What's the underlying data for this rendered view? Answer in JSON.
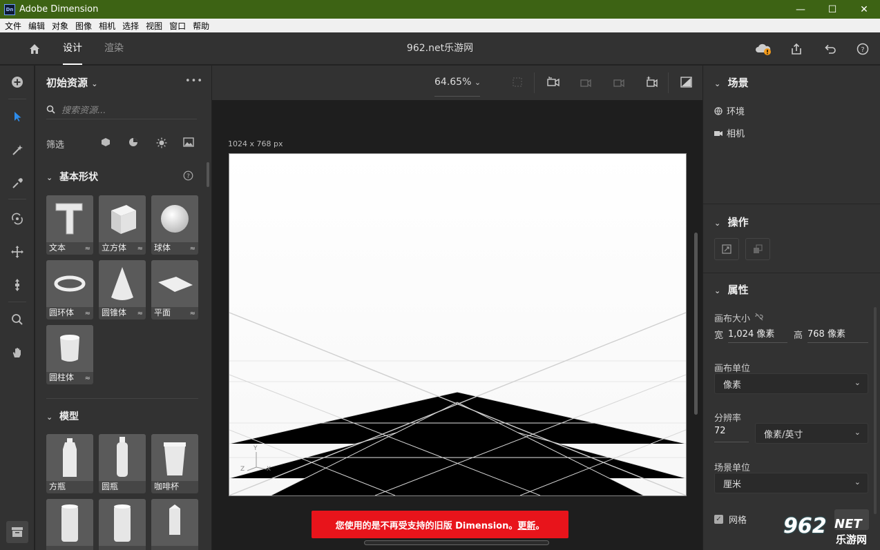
{
  "window": {
    "title": "Adobe Dimension",
    "logo": "Dn",
    "minimize": "—",
    "maximize": "☐",
    "close": "✕"
  },
  "menu": [
    "文件",
    "编辑",
    "对象",
    "图像",
    "相机",
    "选择",
    "视图",
    "窗口",
    "帮助"
  ],
  "header": {
    "tab_design": "设计",
    "tab_render": "渲染",
    "doc_title": "962.net乐游网"
  },
  "assets": {
    "title": "初始资源",
    "more": "•••",
    "search_placeholder": "搜索资源...",
    "filter_label": "筛选",
    "basic_shapes": {
      "title": "基本形状",
      "items": [
        "文本",
        "立方体",
        "球体",
        "圆环体",
        "圆锥体",
        "平面",
        "圆柱体"
      ]
    },
    "models": {
      "title": "模型",
      "items": [
        "方瓶",
        "圆瓶",
        "咖啡杯",
        "",
        ""
      ]
    }
  },
  "canvas": {
    "zoom": "64.65%",
    "size_label": "1024 x 768 px",
    "axis_y": "Y",
    "axis_x": "X",
    "axis_z": "Z"
  },
  "banner": {
    "text": "您使用的是不再受支持的旧版 Dimension。",
    "link": "更新",
    "end": "。",
    "color": "#e8141b"
  },
  "scene": {
    "title": "场景",
    "environment": "环境",
    "camera": "相机"
  },
  "actions": {
    "title": "操作"
  },
  "properties": {
    "title": "属性",
    "canvas_size": "画布大小",
    "width_label": "宽",
    "width_value": "1,024 像素",
    "height_label": "高",
    "height_value": "768 像素",
    "canvas_unit_label": "画布单位",
    "canvas_unit_value": "像素",
    "resolution_label": "分辨率",
    "resolution_value": "72",
    "resolution_unit": "像素/英寸",
    "scene_unit_label": "场景单位",
    "scene_unit_value": "厘米",
    "grid_label": "网格"
  },
  "watermark": {
    "big": "962",
    "net": "NET",
    "sub": "乐游网"
  }
}
